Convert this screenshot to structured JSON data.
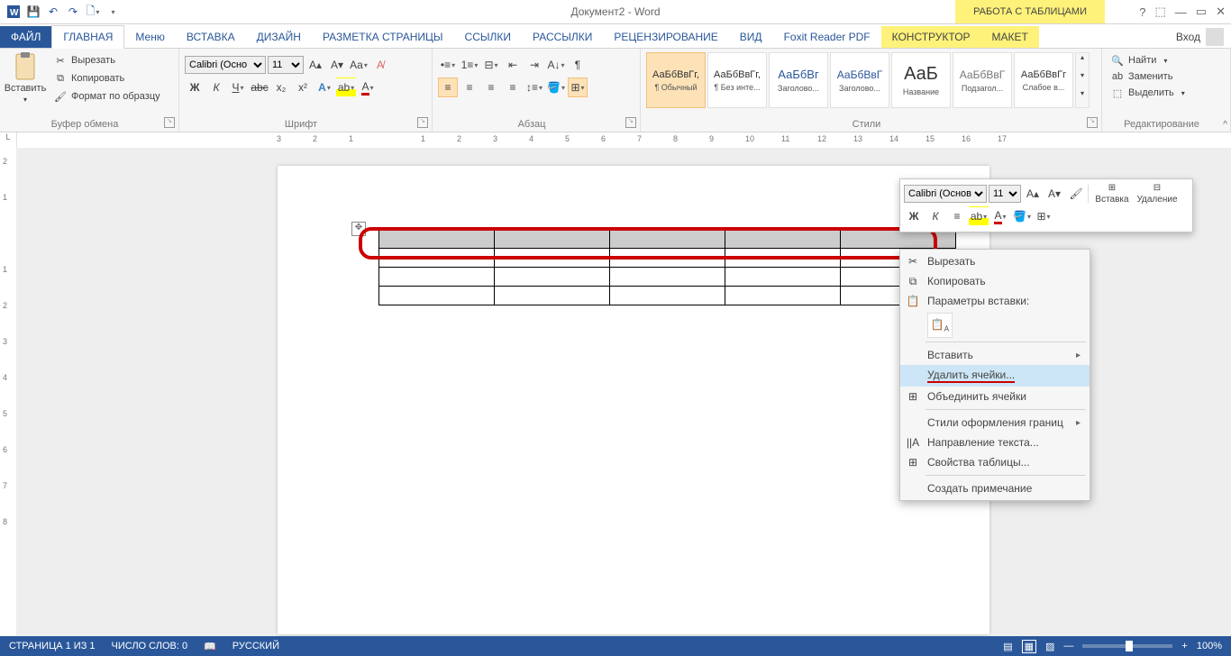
{
  "qat": {
    "title": "Документ2 - Word",
    "tooltab": "РАБОТА С ТАБЛИЦАМИ"
  },
  "sys": {
    "login": "Вход"
  },
  "tabs": {
    "file": "ФАЙЛ",
    "home": "ГЛАВНАЯ",
    "menu": "Меню",
    "insert": "ВСТАВКА",
    "design": "ДИЗАЙН",
    "layout": "РАЗМЕТКА СТРАНИЦЫ",
    "refs": "ССЫЛКИ",
    "mail": "РАССЫЛКИ",
    "review": "РЕЦЕНЗИРОВАНИЕ",
    "view": "ВИД",
    "foxit": "Foxit Reader PDF",
    "ctor": "КОНСТРУКТОР",
    "tlayout": "МАКЕТ"
  },
  "groups": {
    "clipboard": "Буфер обмена",
    "font": "Шрифт",
    "para": "Абзац",
    "styles": "Стили",
    "editing": "Редактирование"
  },
  "clipboard": {
    "paste": "Вставить",
    "cut": "Вырезать",
    "copy": "Копировать",
    "fmt": "Формат по образцу"
  },
  "font": {
    "name": "Calibri (Осно",
    "size": "11"
  },
  "mini": {
    "font": "Calibri (Основн",
    "size": "11",
    "insert": "Вставка",
    "delete": "Удаление"
  },
  "styles": [
    {
      "prev": "АаБбВвГг,",
      "label": "¶ Обычный"
    },
    {
      "prev": "АаБбВвГг,",
      "label": "¶ Без инте..."
    },
    {
      "prev": "АаБбВг",
      "label": "Заголово..."
    },
    {
      "prev": "АаБбВвГ",
      "label": "Заголово..."
    },
    {
      "prev": "АаБ",
      "label": "Название"
    },
    {
      "prev": "АаБбВвГ",
      "label": "Подзагол..."
    },
    {
      "prev": "АаБбВвГг",
      "label": "Слабое в..."
    }
  ],
  "editing": {
    "find": "Найти",
    "replace": "Заменить",
    "select": "Выделить"
  },
  "ruler_h": [
    "3",
    "2",
    "1",
    "1",
    "2",
    "3",
    "4",
    "5",
    "6",
    "7",
    "8",
    "9",
    "10",
    "11",
    "12",
    "13",
    "14",
    "15",
    "16",
    "17"
  ],
  "ruler_v": [
    "2",
    "1",
    "1",
    "2",
    "3",
    "4",
    "5",
    "6",
    "7",
    "8"
  ],
  "ctx": {
    "cut": "Вырезать",
    "copy": "Копировать",
    "pasteopts": "Параметры вставки:",
    "insert": "Вставить",
    "delete": "Удалить ячейки...",
    "merge": "Объединить ячейки",
    "borders": "Стили оформления границ",
    "textdir": "Направление текста...",
    "props": "Свойства таблицы...",
    "comment": "Создать примечание"
  },
  "status": {
    "page": "СТРАНИЦА 1 ИЗ 1",
    "words": "ЧИСЛО СЛОВ: 0",
    "lang": "РУССКИЙ",
    "zoom": "100%"
  }
}
